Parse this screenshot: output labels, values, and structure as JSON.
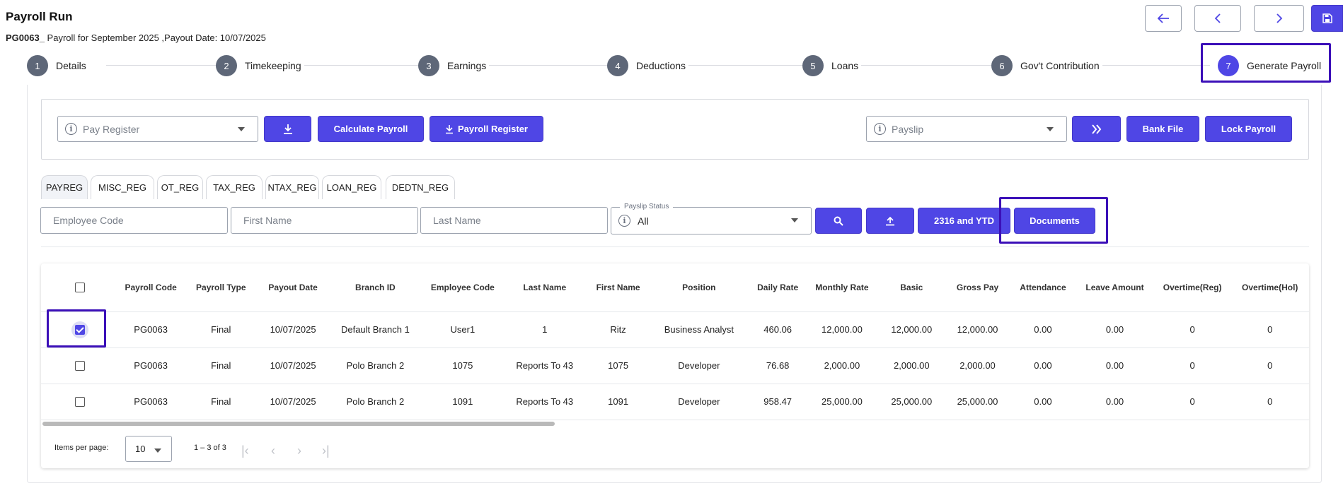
{
  "header": {
    "title": "Payroll Run",
    "code": "PG0063_",
    "subtitle": " Payroll for September 2025 ,Payout Date: 10/07/2025"
  },
  "top_actions": {
    "back_icon": "arrow-left-icon",
    "prev_icon": "chevron-left-icon",
    "next_icon": "chevron-right-icon",
    "save_icon": "save-icon"
  },
  "steps": [
    {
      "num": "1",
      "label": "Details"
    },
    {
      "num": "2",
      "label": "Timekeeping"
    },
    {
      "num": "3",
      "label": "Earnings"
    },
    {
      "num": "4",
      "label": "Deductions"
    },
    {
      "num": "5",
      "label": "Loans"
    },
    {
      "num": "6",
      "label": "Gov't Contribution"
    },
    {
      "num": "7",
      "label": "Generate Payroll"
    }
  ],
  "toolbar": {
    "pay_register_placeholder": "Pay Register",
    "download_icon": "download-icon",
    "calculate_label": "Calculate Payroll",
    "payroll_register_label": "Payroll Register",
    "payslip_placeholder": "Payslip",
    "forward_icon": "double-chevron-right-icon",
    "bank_file_label": "Bank File",
    "lock_payroll_label": "Lock Payroll"
  },
  "tabs": [
    "PAYREG",
    "MISC_REG",
    "OT_REG",
    "TAX_REG",
    "NTAX_REG",
    "LOAN_REG",
    "DEDTN_REG"
  ],
  "filters": {
    "employee_code_placeholder": "Employee Code",
    "first_name_placeholder": "First Name",
    "last_name_placeholder": "Last Name",
    "payslip_status_label": "Payslip Status",
    "payslip_status_value": "All",
    "search_icon": "search-icon",
    "upload_icon": "upload-icon",
    "ytd_label": "2316 and YTD",
    "documents_label": "Documents"
  },
  "table": {
    "columns": [
      "Payroll Code",
      "Payroll Type",
      "Payout Date",
      "Branch ID",
      "Employee Code",
      "Last Name",
      "First Name",
      "Position",
      "Daily Rate",
      "Monthly Rate",
      "Basic",
      "Gross Pay",
      "Attendance",
      "Leave Amount",
      "Overtime(Reg)",
      "Overtime(Hol)"
    ],
    "rows": [
      {
        "checked": true,
        "cells": [
          "PG0063",
          "Final",
          "10/07/2025",
          "Default Branch 1",
          "User1",
          "1",
          "Ritz",
          "Business Analyst",
          "460.06",
          "12,000.00",
          "12,000.00",
          "12,000.00",
          "0.00",
          "0.00",
          "0",
          "0"
        ]
      },
      {
        "checked": false,
        "cells": [
          "PG0063",
          "Final",
          "10/07/2025",
          "Polo Branch 2",
          "1075",
          "Reports To 43",
          "1075",
          "Developer",
          "76.68",
          "2,000.00",
          "2,000.00",
          "2,000.00",
          "0.00",
          "0.00",
          "0",
          "0"
        ]
      },
      {
        "checked": false,
        "cells": [
          "PG0063",
          "Final",
          "10/07/2025",
          "Polo Branch 2",
          "1091",
          "Reports To 43",
          "1091",
          "Developer",
          "958.47",
          "25,000.00",
          "25,000.00",
          "25,000.00",
          "0.00",
          "0.00",
          "0",
          "0"
        ]
      }
    ]
  },
  "pager": {
    "items_per_page_label": "Items per page:",
    "items_per_page_value": "10",
    "range_label": "1 – 3 of 3"
  },
  "colors": {
    "primary": "#4f46e5",
    "highlight": "#3b0fb8",
    "step_inactive": "#5e6778"
  }
}
